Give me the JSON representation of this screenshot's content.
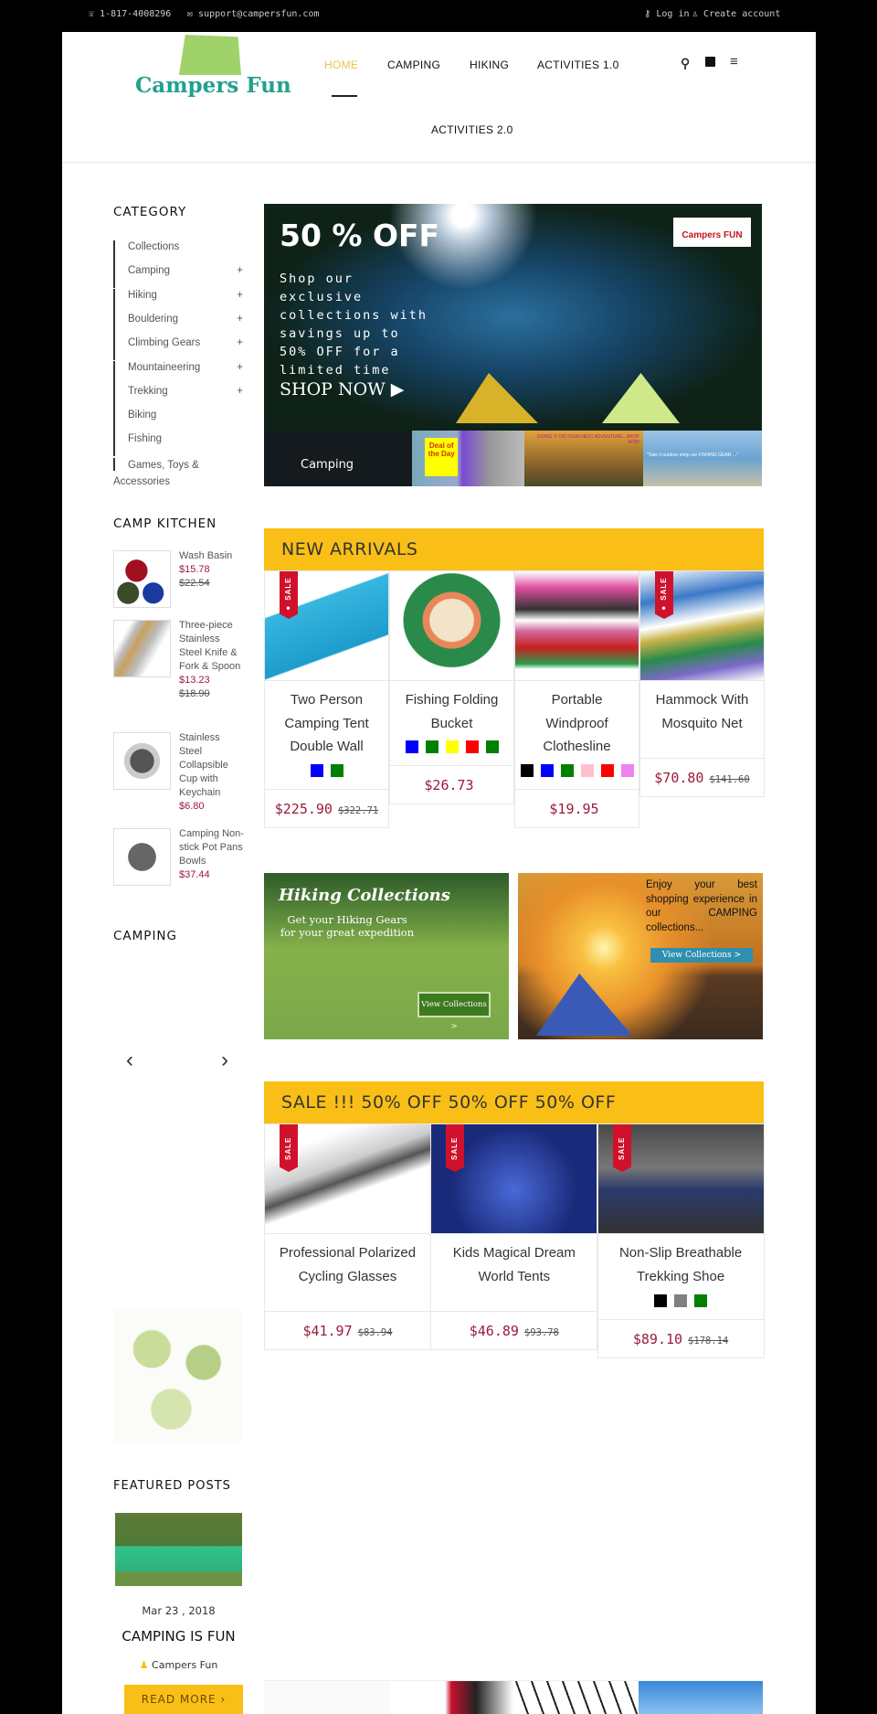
{
  "topbar": {
    "phone": "1-817-4008296",
    "email": "support@campersfun.com",
    "login": "Log in",
    "create": "Create account"
  },
  "logo": {
    "text": "Campers Fun"
  },
  "nav": {
    "items": [
      "HOME",
      "CAMPING",
      "HIKING",
      "ACTIVITIES 1.0",
      "ACTIVITIES 2.0"
    ],
    "active": "HOME",
    "accent": "#e8c44a"
  },
  "icons": [
    "search-icon",
    "shopping-bag-icon",
    "menu-icon"
  ],
  "category": {
    "title": "CATEGORY",
    "items": [
      {
        "label": "Collections",
        "plus": ""
      },
      {
        "label": "Camping",
        "plus": "+"
      },
      {
        "label": "Hiking",
        "plus": "+"
      },
      {
        "label": "Bouldering",
        "plus": "+"
      },
      {
        "label": "Climbing Gears",
        "plus": "+"
      },
      {
        "label": "Mountaineering",
        "plus": "+"
      },
      {
        "label": "Trekking",
        "plus": "+"
      },
      {
        "label": "Biking",
        "plus": ""
      },
      {
        "label": "Fishing",
        "plus": ""
      },
      {
        "label": "Games, Toys & Accessories",
        "plus": ""
      }
    ]
  },
  "hero": {
    "title": "50 % OFF",
    "text": "Shop our exclusive collections with savings up to 50% OFF for a limited time",
    "cta": "SHOP NOW",
    "badge": "Campers FUN",
    "thumbs": [
      {
        "label": "Camping"
      },
      {
        "label": "Deal of the Day"
      },
      {
        "label": "GOING IT ON YOUR NEXT ADVENTURE.. SHOP NOW"
      },
      {
        "label": "\"Take it outdoor shop our FISHING GEAR ...\""
      }
    ]
  },
  "kitchen": {
    "title": "CAMP KITCHEN",
    "items": [
      {
        "name": "Wash Basin",
        "price": "$15.78",
        "old": "$22.54"
      },
      {
        "name": "Three-piece Stainless Steel Knife & Fork & Spoon",
        "price": "$13.23",
        "old": "$18.90"
      },
      {
        "name": "Stainless Steel Collapsible Cup with Keychain",
        "price": "$6.80",
        "old": ""
      },
      {
        "name": "Camping Non-stick Pot Pans Bowls",
        "price": "$37.44",
        "old": ""
      }
    ]
  },
  "camping": {
    "title": "CAMPING",
    "prev": "‹",
    "next": "›"
  },
  "featured": {
    "title": "FEATURED POSTS",
    "date": "Mar 23 , 2018",
    "post_title": "CAMPING IS FUN",
    "author": "Campers Fun",
    "read_more": "READ MORE"
  },
  "new_arrivals": {
    "title": "NEW ARRIVALS",
    "products": [
      {
        "name": "Two Person Camping Tent Double Wall",
        "sale": true,
        "price": "$225.90",
        "old": "$322.71",
        "swatches": [
          "#0000ff",
          "#008000"
        ]
      },
      {
        "name": "Fishing Folding Bucket",
        "sale": false,
        "price": "$26.73",
        "old": "",
        "swatches": [
          "#0000ff",
          "#008000",
          "#ffff00",
          "#ff0000",
          "#008000"
        ]
      },
      {
        "name": "Portable Windproof Clothesline",
        "sale": false,
        "price": "$19.95",
        "old": "",
        "swatches": [
          "#000000",
          "#0000ff",
          "#008000",
          "#ffc0cb",
          "#ff0000",
          "#ee82ee"
        ]
      },
      {
        "name": "Hammock With Mosquito Net",
        "sale": true,
        "price": "$70.80",
        "old": "$141.60",
        "swatches": []
      }
    ]
  },
  "promos": {
    "hiking": {
      "title": "Hiking Collections",
      "sub": "Get your Hiking Gears for your great expedition",
      "cta": "View Collections >"
    },
    "camping": {
      "text": "Enjoy your best shopping experience in our CAMPING collections...",
      "cta": "View Collections >"
    }
  },
  "sale": {
    "title": "SALE !!! 50% OFF 50% OFF 50% OFF",
    "badge": "SALE",
    "products": [
      {
        "name": "Professional Polarized Cycling Glasses",
        "price": "$41.97",
        "old": "$83.94",
        "swatches": []
      },
      {
        "name": "Kids Magical Dream World Tents",
        "price": "$46.89",
        "old": "$93.78",
        "swatches": []
      },
      {
        "name": "Non-Slip Breathable Trekking Shoe",
        "price": "$89.10",
        "old": "$178.14",
        "swatches": [
          "#000000",
          "#808080",
          "#008000"
        ]
      }
    ]
  }
}
